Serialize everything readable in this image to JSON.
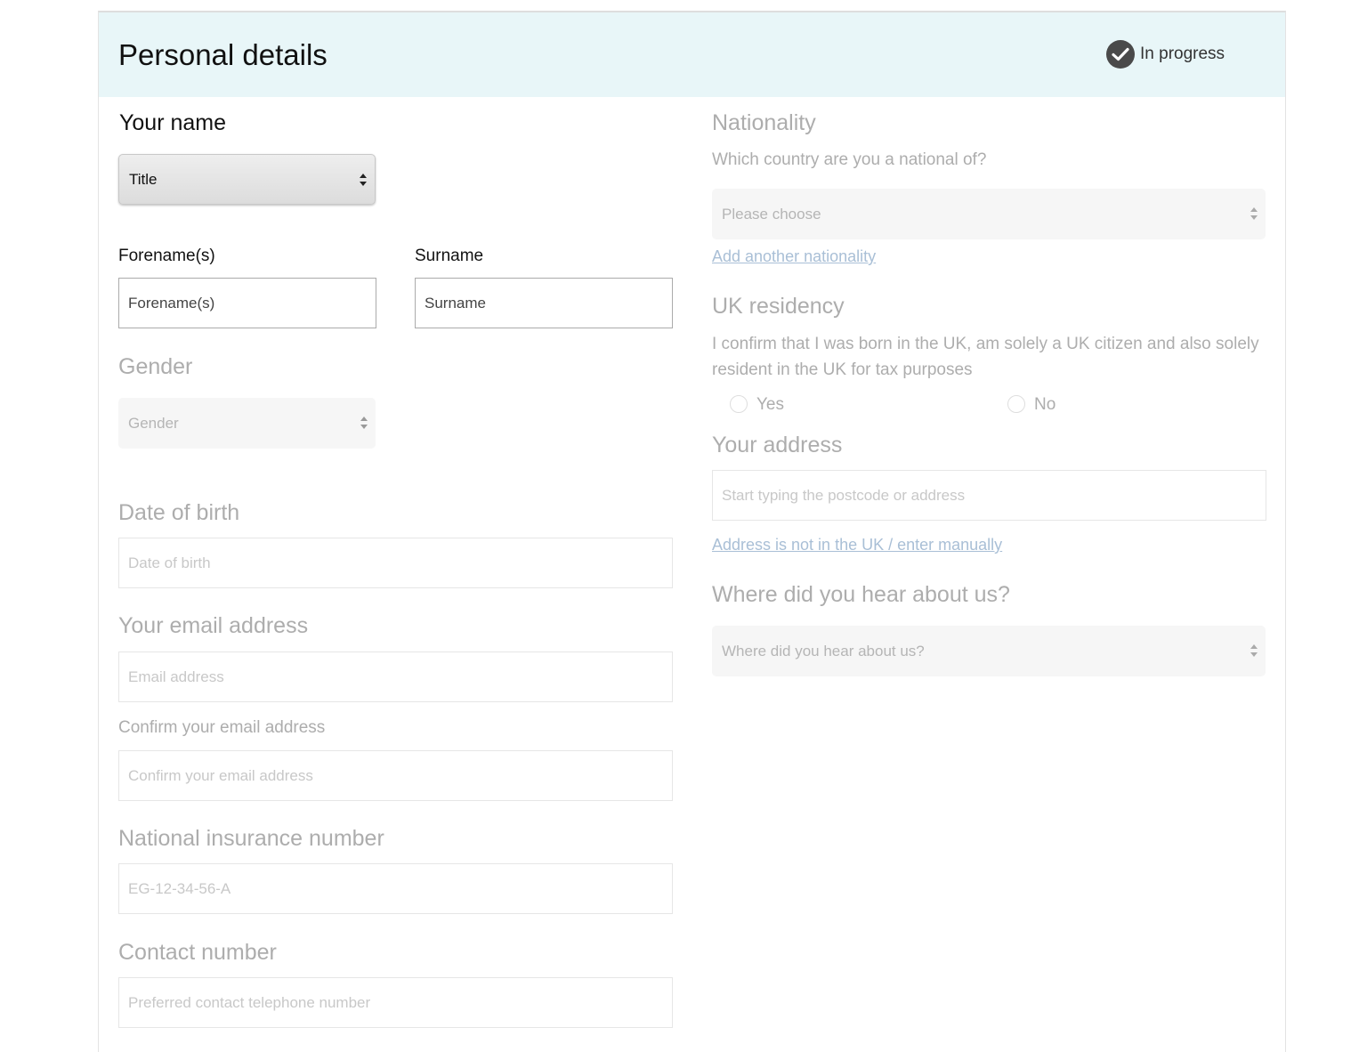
{
  "header": {
    "title": "Personal details",
    "status": "In progress"
  },
  "left": {
    "your_name_heading": "Your name",
    "title_select": "Title",
    "forename_label": "Forename(s)",
    "forename_placeholder": "Forename(s)",
    "surname_label": "Surname",
    "surname_placeholder": "Surname",
    "gender_heading": "Gender",
    "gender_select": "Gender",
    "dob_heading": "Date of birth",
    "dob_placeholder": "Date of birth",
    "email_heading": "Your email address",
    "email_placeholder": "Email address",
    "confirm_email_label": "Confirm your email address",
    "confirm_email_placeholder": "Confirm your email address",
    "ni_heading": "National insurance number",
    "ni_placeholder": "EG-12-34-56-A",
    "contact_heading": "Contact number",
    "contact_placeholder": "Preferred contact telephone number"
  },
  "right": {
    "nationality_heading": "Nationality",
    "nationality_question": "Which country are you a national of?",
    "nationality_select": "Please choose",
    "add_nationality_link": "Add another nationality",
    "residency_heading": "UK residency",
    "residency_text": "I confirm that I was born in the UK, am solely a UK citizen and also solely resident in the UK for tax purposes",
    "yes_label": "Yes",
    "no_label": "No",
    "address_heading": "Your address",
    "address_placeholder": "Start typing the postcode or address",
    "address_manual_link": "Address is not in the UK / enter manually",
    "hear_heading": "Where did you hear about us?",
    "hear_select": "Where did you hear about us?"
  }
}
